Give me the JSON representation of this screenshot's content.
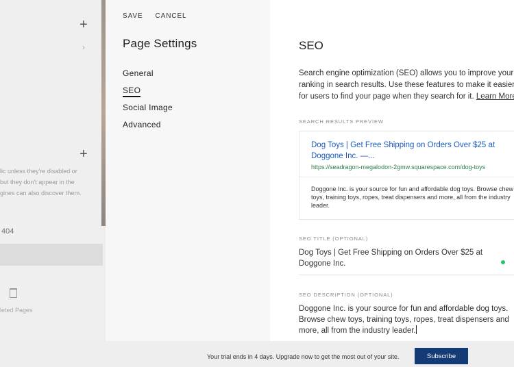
{
  "background": {
    "partial_text_lines": [
      "lic unless they're disabled or",
      " but they don't appear in the",
      "gines can also discover them."
    ],
    "page_404_label": "404",
    "deleted_pages_label": "leted Pages"
  },
  "modal": {
    "toolbar": {
      "save_label": "SAVE",
      "cancel_label": "CANCEL"
    },
    "title": "Page Settings",
    "nav_items": [
      "General",
      "SEO",
      "Social Image",
      "Advanced"
    ],
    "active_nav": "SEO"
  },
  "seo": {
    "title": "SEO",
    "intro": "Search engine optimization (SEO) allows you to improve your ranking in search results. Use these features to make it easier for users to find your page when they search for it.",
    "learn_more": "Learn More",
    "preview_label": "SEARCH RESULTS PREVIEW",
    "preview": {
      "title": "Dog Toys | Get Free Shipping on Orders Over $25 at Doggone Inc. —...",
      "url": "https://seadragon-megalodon-2gmw.squarespace.com/dog-toys",
      "description": "Doggone Inc. is your source for fun and affordable dog toys. Browse chew toys, training toys, ropes, treat dispensers and more, all from the industry leader."
    },
    "seo_title_label": "SEO TITLE (OPTIONAL)",
    "seo_title_value": "Dog Toys | Get Free Shipping on Orders Over $25 at Doggone Inc.",
    "seo_description_label": "SEO DESCRIPTION (OPTIONAL)",
    "seo_description_value": "Doggone Inc. is your source for fun and affordable dog toys. Browse chew toys, training toys, ropes, treat dispensers and more, all from the industry leader."
  },
  "footer": {
    "trial_text": "Your trial ends in 4 days. Upgrade now to get the most out of your site.",
    "subscribe_label": "Subscribe",
    "subscribe_color": "#143b76"
  },
  "icons": [
    "plus-icon",
    "chevron-right-icon",
    "trash-icon",
    "check-dot-icon"
  ]
}
